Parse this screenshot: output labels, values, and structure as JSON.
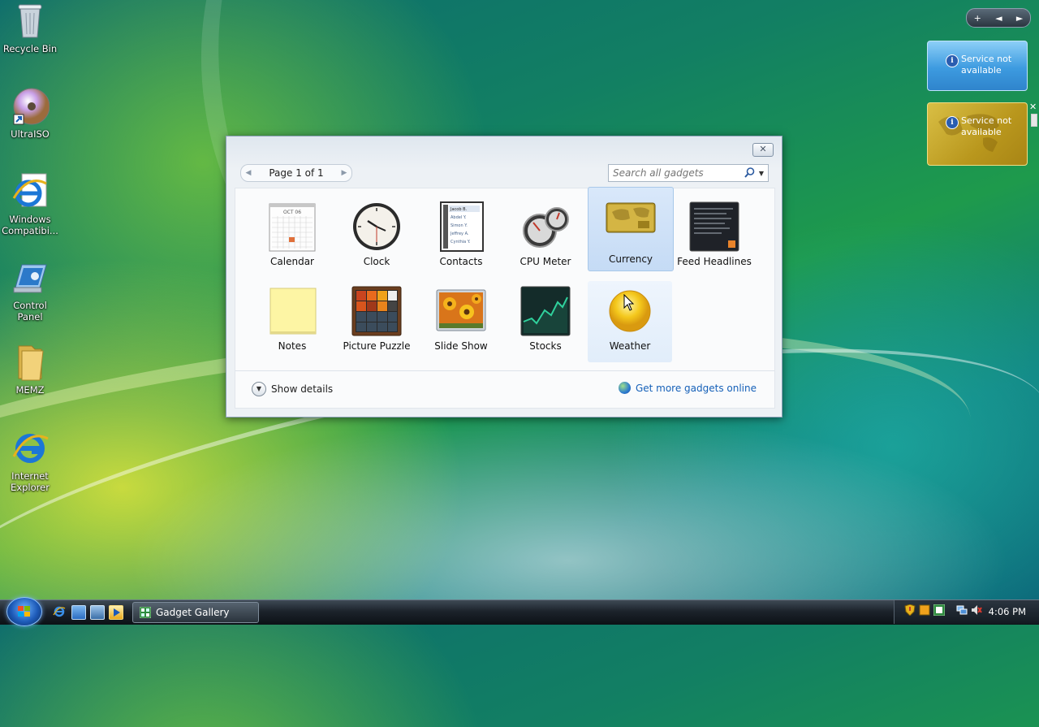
{
  "desktop": {
    "icons": [
      {
        "label": "Recycle Bin",
        "icon": "recycle-bin-icon"
      },
      {
        "label": "UltraISO",
        "icon": "ultraiso-disc-icon"
      },
      {
        "label": "Windows Compatibi...",
        "icon": "internet-explorer-icon"
      },
      {
        "label": "Control Panel",
        "icon": "control-panel-icon"
      },
      {
        "label": "MEMZ",
        "icon": "folder-icon"
      },
      {
        "label": "Internet Explorer",
        "icon": "internet-explorer-icon"
      }
    ]
  },
  "sidebar": {
    "controls": [
      "+",
      "◄",
      "►"
    ],
    "gadgets": [
      {
        "message": "Service not available",
        "type": "weather"
      },
      {
        "message": "Service not available",
        "type": "currency"
      }
    ]
  },
  "gallery": {
    "close_label": "✕",
    "pager": {
      "text": "Page 1 of 1"
    },
    "search": {
      "placeholder": "Search all gadgets"
    },
    "gadgets": [
      {
        "label": "Calendar",
        "icon": "calendar-icon"
      },
      {
        "label": "Clock",
        "icon": "clock-icon"
      },
      {
        "label": "Contacts",
        "icon": "contacts-icon"
      },
      {
        "label": "CPU Meter",
        "icon": "cpu-meter-icon"
      },
      {
        "label": "Currency",
        "icon": "currency-icon",
        "selected": true
      },
      {
        "label": "Feed Headlines",
        "icon": "feed-headlines-icon"
      },
      {
        "label": "Notes",
        "icon": "notes-icon"
      },
      {
        "label": "Picture Puzzle",
        "icon": "picture-puzzle-icon"
      },
      {
        "label": "Slide Show",
        "icon": "slide-show-icon"
      },
      {
        "label": "Stocks",
        "icon": "stocks-icon"
      },
      {
        "label": "Weather",
        "icon": "weather-icon",
        "hovered": true
      }
    ],
    "calendar_month": "OCT 06",
    "contacts_names": [
      "Jacob B.",
      "Abdel Y.",
      "Simon Y.",
      "Jeffrey A.",
      "Cynthia Y."
    ],
    "show_details": "Show details",
    "get_more": "Get more gadgets online"
  },
  "taskbar": {
    "task_button": "Gadget Gallery",
    "clock": "4:06 PM"
  },
  "colors": {
    "link": "#1560b8",
    "selected_tile": "#c5dbf5",
    "currency_gadget": "#c9a92a",
    "weather_gadget": "#4fa9e6"
  }
}
